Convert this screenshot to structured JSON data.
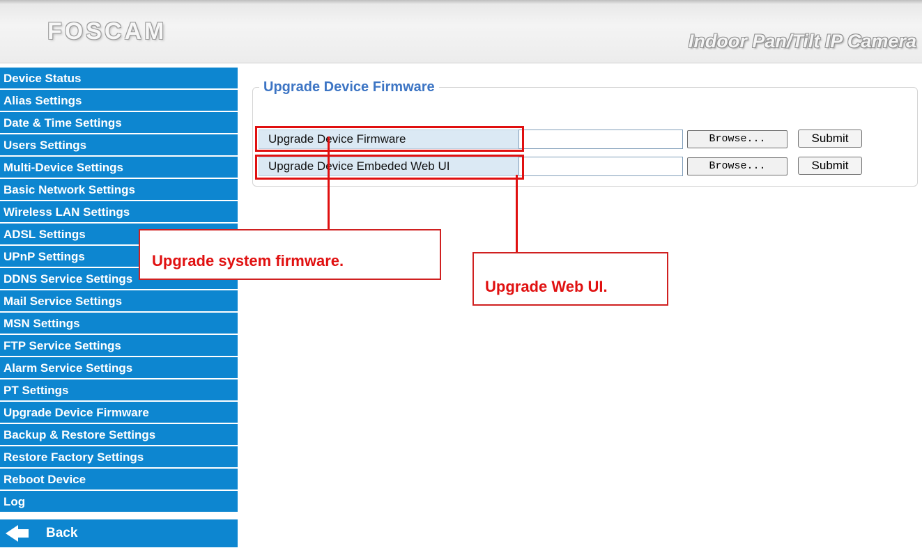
{
  "header": {
    "logo": "FOSCAM",
    "product": "Indoor Pan/Tilt IP Camera"
  },
  "sidebar": {
    "items": [
      {
        "label": "Device Status"
      },
      {
        "label": "Alias Settings"
      },
      {
        "label": "Date & Time Settings"
      },
      {
        "label": "Users Settings"
      },
      {
        "label": "Multi-Device Settings"
      },
      {
        "label": "Basic Network Settings"
      },
      {
        "label": "Wireless LAN Settings"
      },
      {
        "label": "ADSL Settings"
      },
      {
        "label": "UPnP Settings"
      },
      {
        "label": "DDNS Service Settings"
      },
      {
        "label": "Mail Service Settings"
      },
      {
        "label": "MSN Settings"
      },
      {
        "label": "FTP Service Settings"
      },
      {
        "label": "Alarm Service Settings"
      },
      {
        "label": "PT Settings"
      },
      {
        "label": "Upgrade Device Firmware"
      },
      {
        "label": "Backup & Restore Settings"
      },
      {
        "label": "Restore Factory Settings"
      },
      {
        "label": "Reboot Device"
      },
      {
        "label": "Log"
      }
    ],
    "back_label": "Back",
    "back_icon": "arrow-left-icon"
  },
  "main": {
    "legend": "Upgrade Device Firmware",
    "rows": [
      {
        "label": "Upgrade Device Firmware",
        "browse": "Browse...",
        "submit": "Submit"
      },
      {
        "label": "Upgrade Device Embeded Web UI",
        "browse": "Browse...",
        "submit": "Submit"
      }
    ]
  },
  "callouts": {
    "firmware": "Upgrade system firmware.",
    "webui": "Upgrade Web UI."
  },
  "colors": {
    "sidebar_bg": "#0d86d0",
    "legend": "#3d75c4",
    "annotation": "#e01010"
  }
}
